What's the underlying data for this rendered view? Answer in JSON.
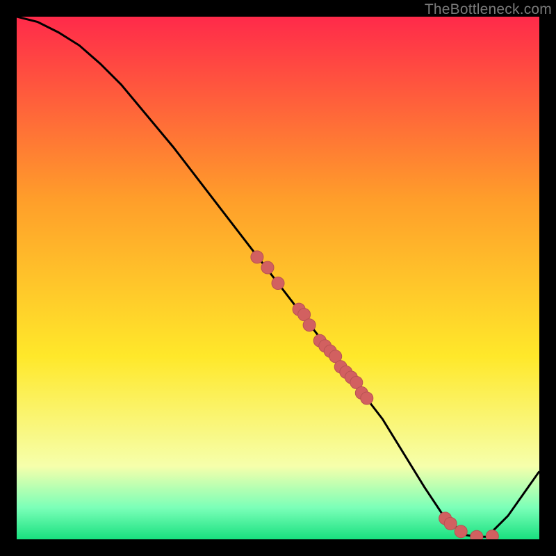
{
  "watermark": "TheBottleneck.com",
  "colors": {
    "background": "#000000",
    "curve": "#000000",
    "dot_fill": "#d26060",
    "dot_stroke": "#b85252",
    "gradient_top": "#ff2a4a",
    "gradient_mid1": "#ff9e2a",
    "gradient_mid2": "#ffe82a",
    "gradient_mid3": "#f6ffab",
    "gradient_bottom1": "#7affb8",
    "gradient_bottom2": "#18e07f"
  },
  "chart_data": {
    "type": "line",
    "title": "",
    "xlabel": "",
    "ylabel": "",
    "xlim": [
      0,
      100
    ],
    "ylim": [
      0,
      100
    ],
    "curve": {
      "x": [
        0,
        4,
        8,
        12,
        16,
        20,
        30,
        40,
        50,
        60,
        70,
        78,
        82,
        86,
        88,
        90,
        94,
        100
      ],
      "y": [
        100,
        99,
        97,
        94.5,
        91,
        87,
        75,
        62,
        49,
        36,
        23,
        10,
        4,
        0.8,
        0.5,
        0.5,
        4.5,
        13
      ]
    },
    "series": [
      {
        "name": "points",
        "x": [
          46,
          48,
          50,
          54,
          55,
          56,
          58,
          59,
          60,
          61,
          62,
          63,
          64,
          65,
          66,
          67,
          82,
          83,
          85,
          88,
          91
        ],
        "y": [
          54,
          52,
          49,
          44,
          43,
          41,
          38,
          37,
          36,
          35,
          33,
          32,
          31,
          30,
          28,
          27,
          4.0,
          3.0,
          1.5,
          0.5,
          0.6
        ]
      }
    ],
    "annotations": []
  }
}
